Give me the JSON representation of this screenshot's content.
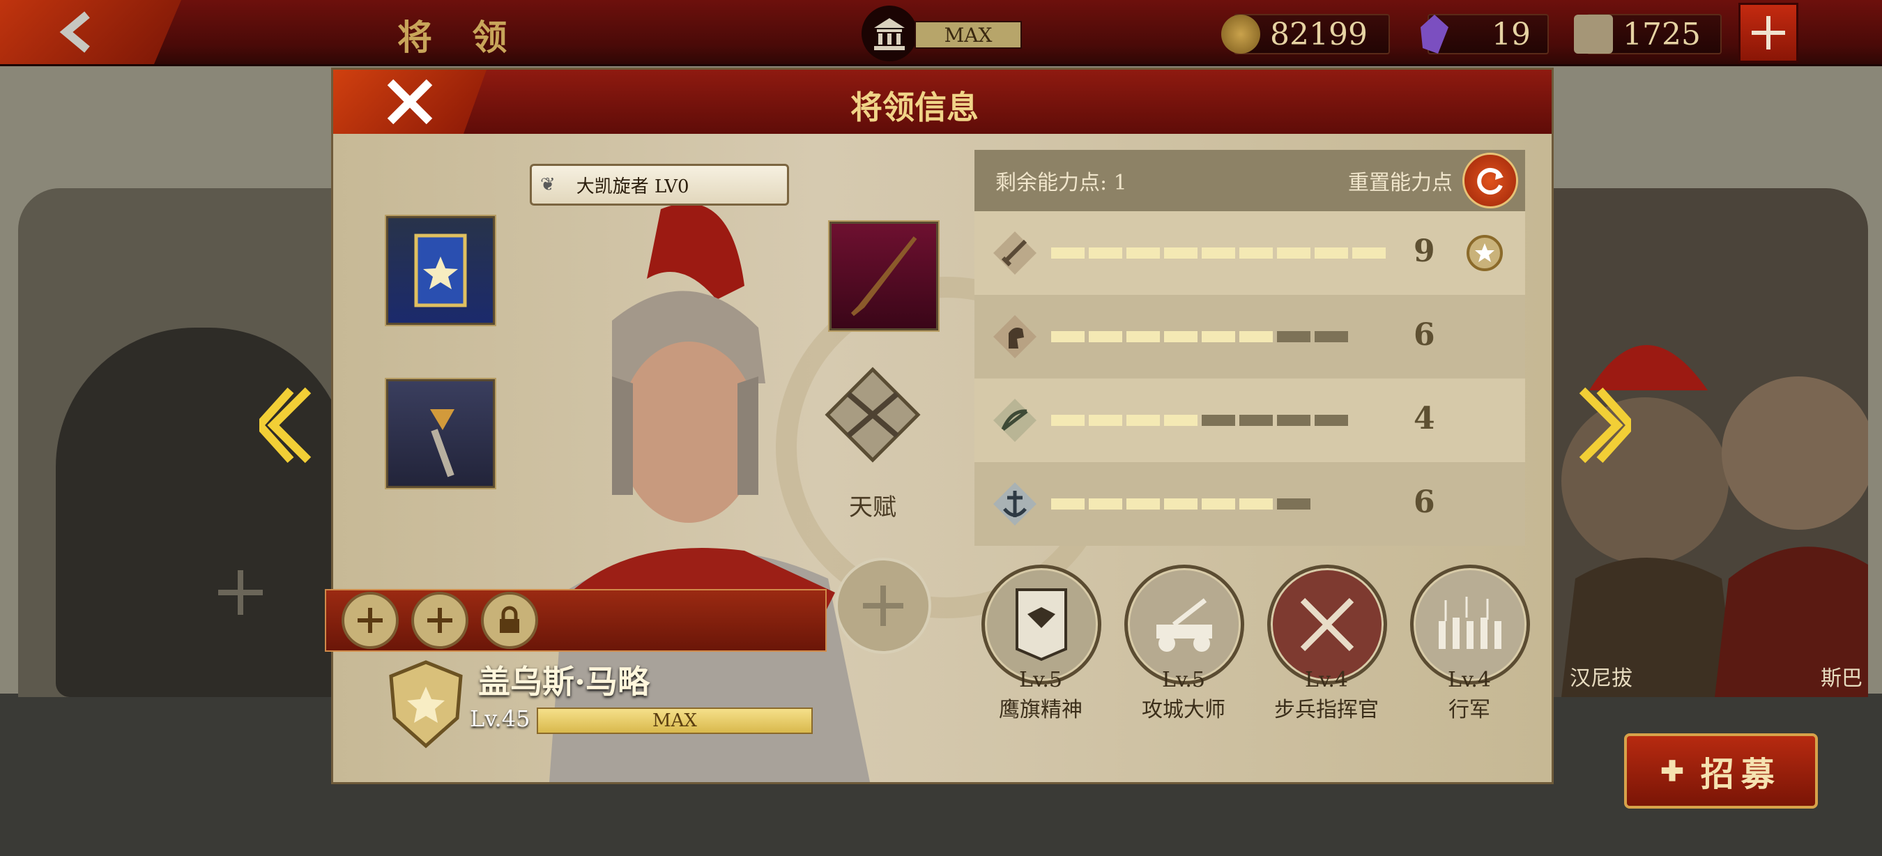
{
  "topbar": {
    "title": "将 领",
    "building_level": "MAX",
    "coins": "82199",
    "gems": "19",
    "tokens": "1725"
  },
  "background": {
    "heroes_right": [
      "汉尼拔",
      "斯巴"
    ]
  },
  "recruit": {
    "label": "招募"
  },
  "dialog": {
    "title": "将领信息",
    "hero": {
      "title_badge": "大凯旋者 LV0",
      "name": "盖乌斯·马略",
      "level": "Lv.45",
      "xp_label": "MAX",
      "xp_progress": 1.0
    },
    "talent_label": "天赋",
    "points": {
      "label": "剩余能力点: 1",
      "reset_label": "重置能力点"
    },
    "stats": [
      {
        "icon": "sword-icon",
        "value": "9",
        "filled": 9,
        "total": 9
      },
      {
        "icon": "horse-icon",
        "value": "6",
        "filled": 6,
        "total": 8
      },
      {
        "icon": "bow-icon",
        "value": "4",
        "filled": 4,
        "total": 8
      },
      {
        "icon": "anchor-icon",
        "value": "6",
        "filled": 6,
        "total": 7
      }
    ],
    "skills": [
      {
        "level": "Lv.5",
        "name": "鹰旗精神"
      },
      {
        "level": "Lv.5",
        "name": "攻城大师"
      },
      {
        "level": "Lv.4",
        "name": "步兵指挥官"
      },
      {
        "level": "Lv.4",
        "name": "行军"
      }
    ]
  }
}
